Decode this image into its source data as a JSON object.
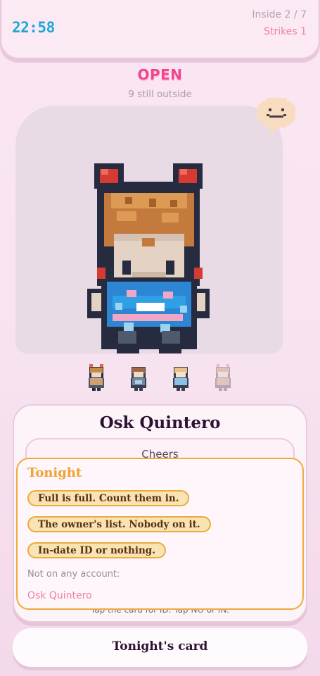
{
  "hud": {
    "clock": "22:58",
    "inside": "Inside 2 / 7",
    "strikes": "Strikes 1"
  },
  "door": {
    "status": "OPEN",
    "outside_count": "9 still outside"
  },
  "guest": {
    "name": "Osk Quintero",
    "greeting": "Cheers",
    "hint": "Tap the card for ID. Tap NO or IN."
  },
  "rules": {
    "title": "Tonight",
    "items": [
      "Full is full. Count them in.",
      "The owner's list. Nobody on it.",
      "In-date ID or nothing."
    ],
    "not_on_account_label": "Not on any account:",
    "not_on_account_names": [
      "Osk Quintero"
    ]
  },
  "footer": {
    "button": "Tonight's card"
  },
  "queue": {
    "count": 4
  }
}
